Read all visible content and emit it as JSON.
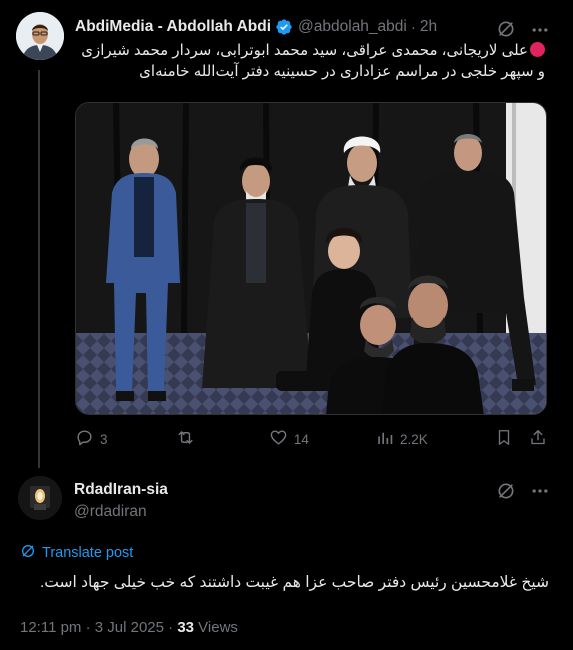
{
  "post": {
    "author_name": "AbdiMedia - Abdollah Abdi",
    "handle": "@abdolah_abdi",
    "separator": "·",
    "time": "2h",
    "text": "علی لاریجانی، محمدی عراقی، سید محمد ابوترابی، سردار محمد شیرازی و سپهر خلجی در مراسم عزاداری در حسینیه دفتر آیت‌الله خامنه‌ای",
    "image_alt": "Photo of men seated at a mourning ceremony in a hall with black drapes",
    "stats": {
      "replies": "3",
      "reposts": "",
      "likes": "14",
      "views": "2.2K"
    }
  },
  "reply": {
    "author_name": "RdadIran-sia",
    "handle": "@rdadiran",
    "translate_label": "Translate post",
    "text": "شیخ غلامحسین رئیس دفتر صاحب عزا هم غیبت داشتند  که خب خیلی جهاد است.",
    "timestamp": "12:11 pm · 3 Jul 2025 · ",
    "view_count": "33",
    "views_label": " Views"
  },
  "colors": {
    "background": "#000000",
    "text_primary": "#e7e9ea",
    "text_secondary": "#71767b",
    "accent": "#1d9bf0",
    "red_dot": "#e0245e"
  }
}
